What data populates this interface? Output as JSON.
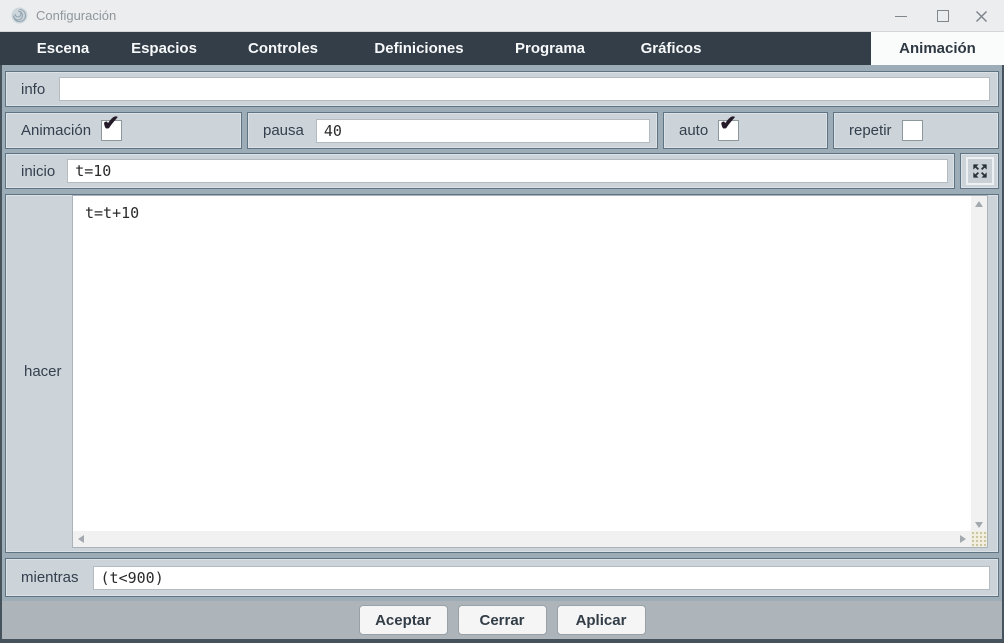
{
  "window": {
    "title": "Configuración"
  },
  "tabs": [
    {
      "label": "Escena",
      "active": false
    },
    {
      "label": "Espacios",
      "active": false
    },
    {
      "label": "Controles",
      "active": false
    },
    {
      "label": "Definiciones",
      "active": false
    },
    {
      "label": "Programa",
      "active": false
    },
    {
      "label": "Gráficos",
      "active": false
    },
    {
      "label": "Animación",
      "active": true
    }
  ],
  "form": {
    "info": {
      "label": "info",
      "value": ""
    },
    "animacion": {
      "label": "Animación",
      "checked": true,
      "mark": "✔"
    },
    "pausa": {
      "label": "pausa",
      "value": "40"
    },
    "auto": {
      "label": "auto",
      "checked": true,
      "mark": "✔"
    },
    "repetir": {
      "label": "repetir",
      "checked": false,
      "mark": ""
    },
    "inicio": {
      "label": "inicio",
      "value": "t=10"
    },
    "hacer": {
      "label": "hacer",
      "value": "t=t+10"
    },
    "mientras": {
      "label": "mientras",
      "value": "(t<900)"
    }
  },
  "buttons": {
    "accept": "Aceptar",
    "close": "Cerrar",
    "apply": "Aplicar"
  },
  "icons": {
    "app": "spiral-logo-icon",
    "expand": "expand-arrows-icon",
    "window": [
      "minimize-icon",
      "maximize-icon",
      "close-icon"
    ]
  },
  "colors": {
    "tab_bar": "#333e48",
    "active_tab_bg": "#fafbfb",
    "panel_bg": "#ccd3d9",
    "panel_border": "#5f7382",
    "content_bg": "#9dadb8",
    "label_text": "#333f4d",
    "check_mark": "#241a28",
    "button_bar_bg": "#adb5ba"
  }
}
